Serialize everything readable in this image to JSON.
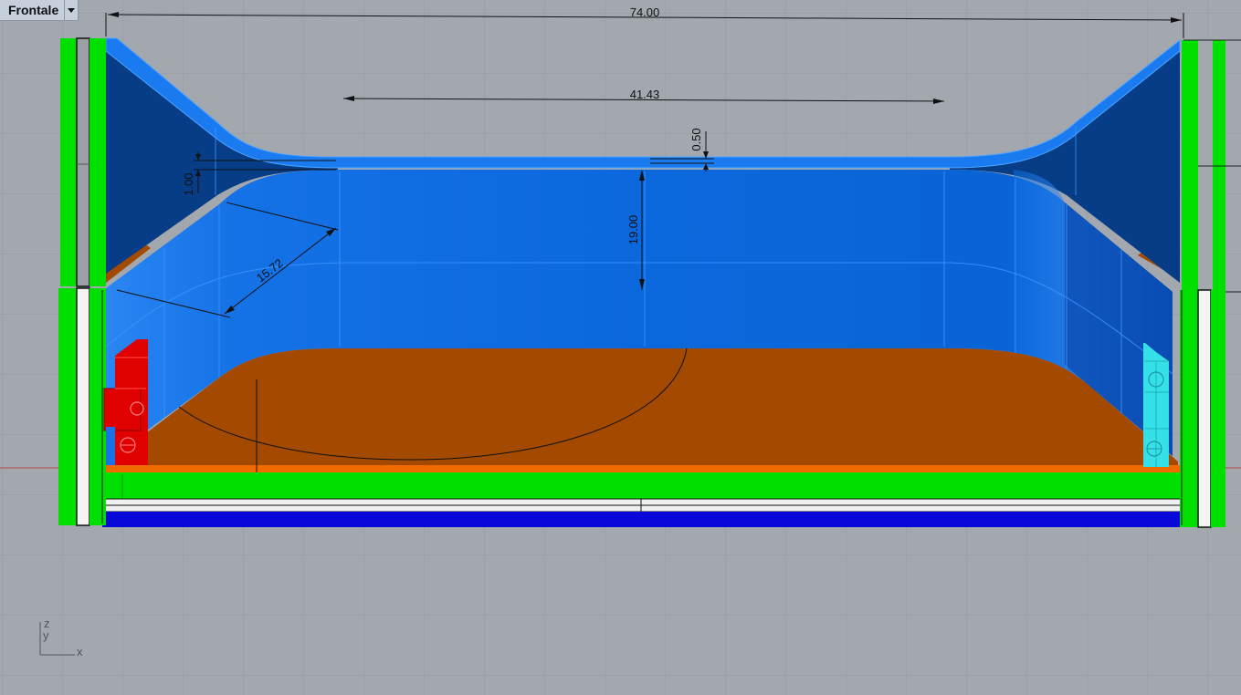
{
  "viewport": {
    "name": "Frontale"
  },
  "dimensions": {
    "overall_width": "74.00",
    "inner_width": "41.43",
    "top_thickness": "0.50",
    "side_thickness": "1.00",
    "height": "19.00",
    "slope_length": "15.72"
  },
  "axis_gizmo": {
    "z": "z",
    "y": "y",
    "x": "x"
  },
  "colors": {
    "background": "#a3a7ae",
    "grid": "#949aa2",
    "blue_surface": "#0b6ae0",
    "blue_dark": "#063d86",
    "orange_floor": "#a44a00",
    "green_frame": "#00e000",
    "red_part": "#e00000",
    "cyan_part": "#35e0e8",
    "blue_base": "#0808d8"
  }
}
